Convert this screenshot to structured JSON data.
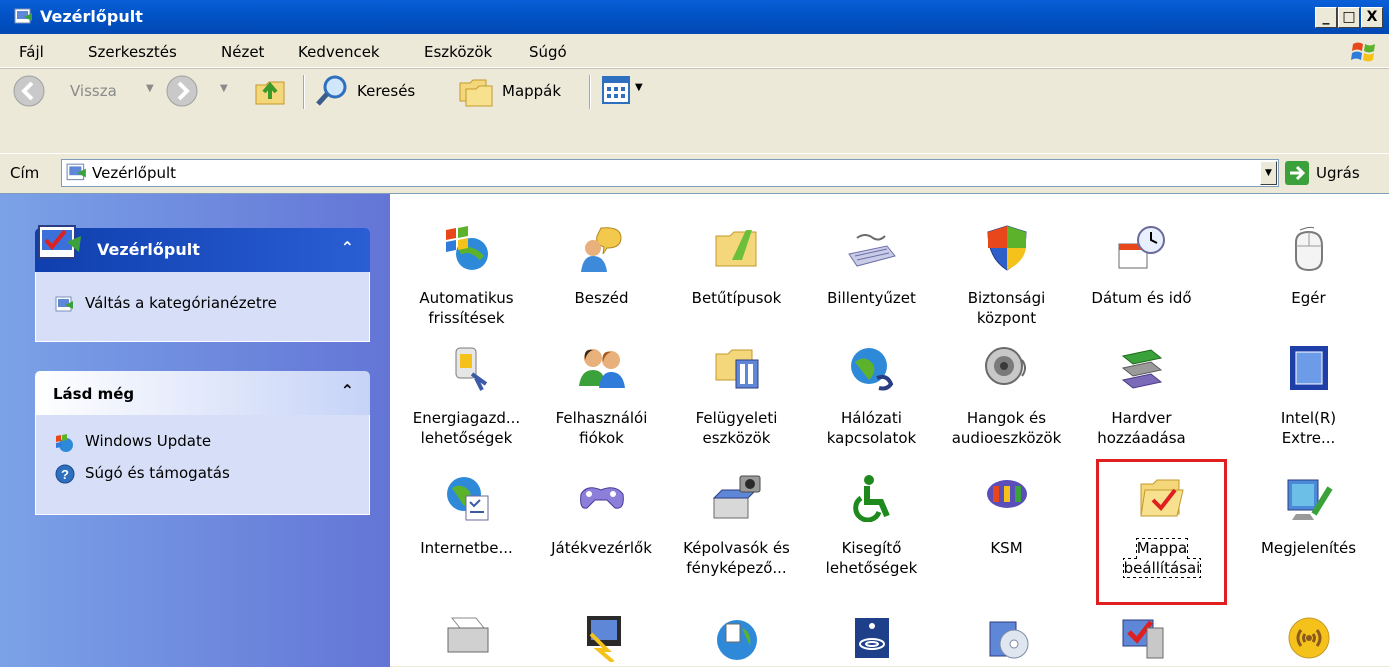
{
  "window": {
    "title": "Vezérlőpult",
    "min": "_",
    "max": "□",
    "close": "X"
  },
  "menu": [
    "Fájl",
    "Szerkesztés",
    "Nézet",
    "Kedvencek",
    "Eszközök",
    "Súgó"
  ],
  "toolbar": {
    "back": "Vissza",
    "search": "Keresés",
    "folders": "Mappák"
  },
  "address": {
    "label": "Cím",
    "value": "Vezérlőpult",
    "go": "Ugrás"
  },
  "sidebar": {
    "panel_title": "Vezérlőpult",
    "switch_link": "Váltás a kategórianézetre",
    "see_also_title": "Lásd még",
    "see_also": [
      "Windows Update",
      "Súgó és támogatás"
    ]
  },
  "items": [
    "Automatikus\nfrissítések",
    "Beszéd",
    "Betűtípusok",
    "Billentyűzet",
    "Biztonsági\nközpont",
    "Dátum és idő",
    "Egér",
    "Energiagazd...\nlehetőségek",
    "Felhasználói\nfiókok",
    "Felügyeleti\neszközök",
    "Hálózati\nkapcsolatok",
    "Hangok és\naudioeszközök",
    "Hardver\nhozzáadása",
    "Intel(R)\nExtre...",
    "Internetbe...",
    "Játékvezérlők",
    "Képolvasók és\nfényképező...",
    "Kisegítő\nlehetőségek",
    "KSM",
    "Mappa\nbeállításai",
    "Megjelenítés"
  ],
  "colors": {
    "xp_blue": "#0A5FD8",
    "highlight_red": "#E02020",
    "sidebar_blue": "#6375D6"
  }
}
